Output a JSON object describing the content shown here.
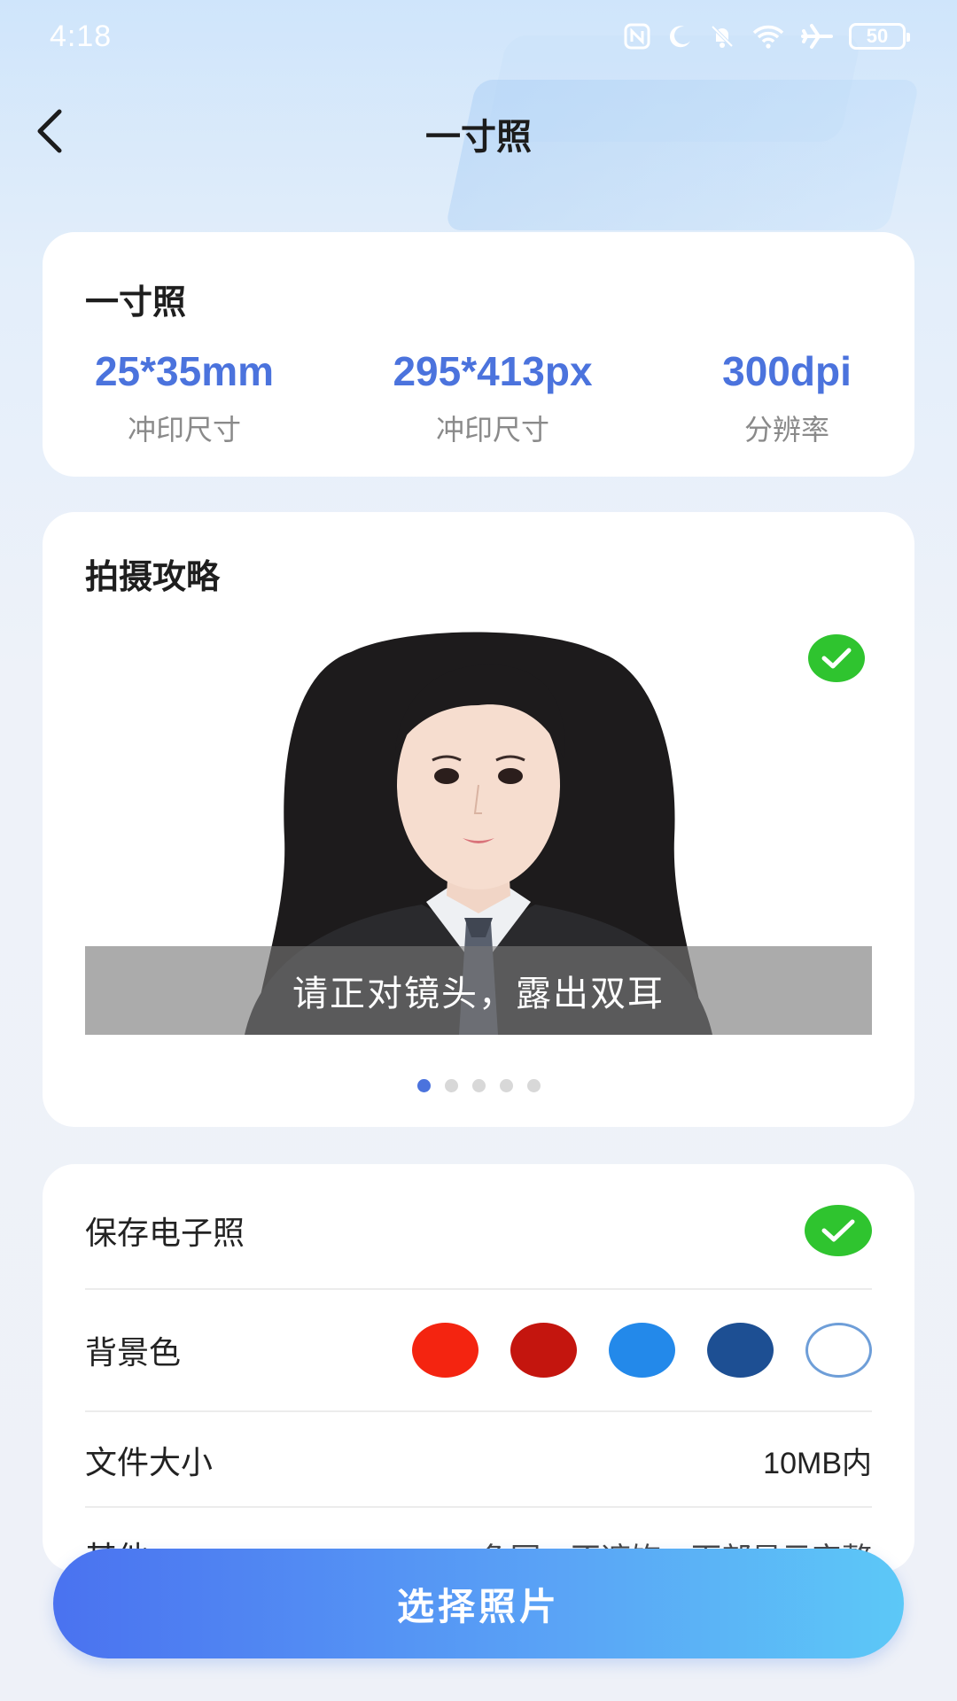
{
  "status_bar": {
    "time": "4:18",
    "battery": "50",
    "icons": [
      "nfc-icon",
      "moon-icon",
      "bell-off-icon",
      "wifi-icon",
      "airplane-icon",
      "battery-icon"
    ]
  },
  "header": {
    "title": "一寸照",
    "back_icon": "chevron-left-icon"
  },
  "spec": {
    "title": "一寸照",
    "items": [
      {
        "value": "25*35mm",
        "label": "冲印尺寸"
      },
      {
        "value": "295*413px",
        "label": "冲印尺寸"
      },
      {
        "value": "300dpi",
        "label": "分辨率"
      }
    ]
  },
  "guide": {
    "title": "拍摄攻略",
    "caption": "请正对镜头，露出双耳",
    "page_count": 5,
    "active_page": 1
  },
  "options": {
    "save_label": "保存电子照",
    "save_checked": true,
    "bg_label": "背景色",
    "bg_colors": [
      "#f42410",
      "#c4150e",
      "#2389ea",
      "#1d4f93",
      "#ffffff"
    ],
    "size_label": "文件大小",
    "size_value": "10MB内",
    "other_label": "其他",
    "other_value": "免冠、不遮饰、面部显示完整"
  },
  "action": {
    "button_label": "选择照片"
  },
  "colors": {
    "accent": "#4b73dd",
    "check_green": "#2fc42f"
  }
}
